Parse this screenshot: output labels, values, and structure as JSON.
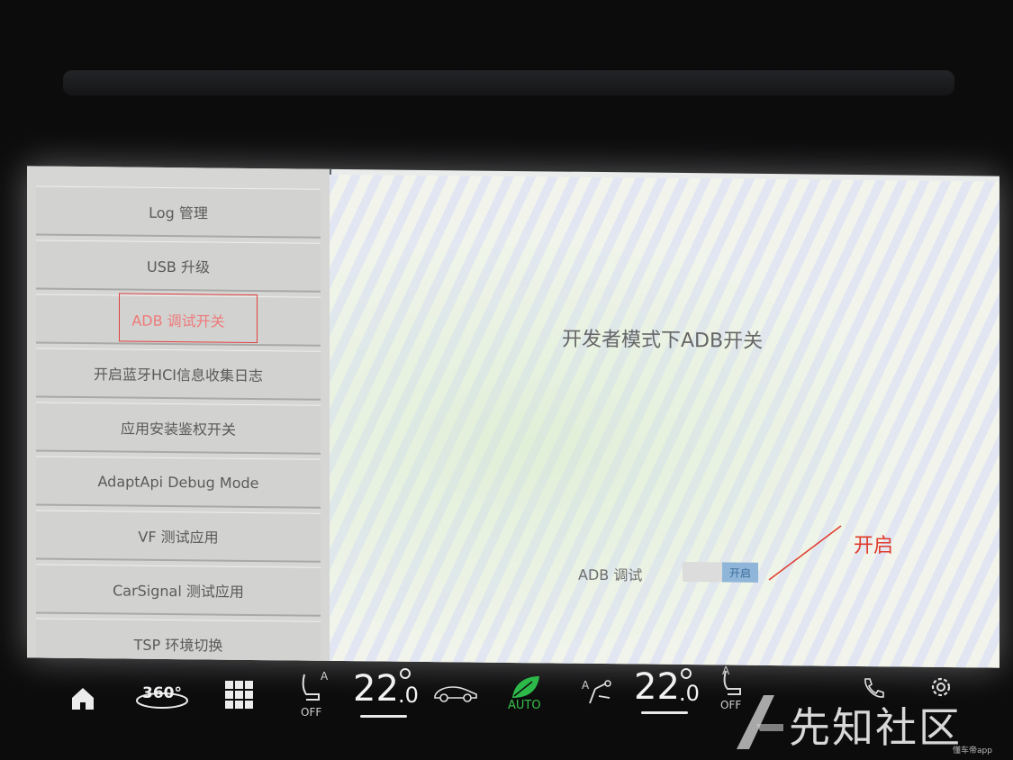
{
  "sidebar": {
    "items": [
      {
        "label": "Log 管理"
      },
      {
        "label": "USB 升级"
      },
      {
        "label": "ADB 调试开关"
      },
      {
        "label": "开启蓝牙HCI信息收集日志"
      },
      {
        "label": "应用安装鉴权开关"
      },
      {
        "label": "AdaptApi Debug Mode"
      },
      {
        "label": "VF 测试应用"
      },
      {
        "label": "CarSignal 测试应用"
      },
      {
        "label": "TSP 环境切换"
      }
    ],
    "active_index": 2
  },
  "content": {
    "title": "开发者模式下ADB开关",
    "adb_label": "ADB 调试",
    "toggle_text": "开启",
    "toggle_on": true
  },
  "annotation": {
    "text": "开启",
    "color": "#e03a2a"
  },
  "dock": {
    "icons": [
      "home-icon",
      "360-view-icon",
      "apps-grid-icon",
      "driver-seat-icon",
      "car-icon",
      "eco-leaf-icon",
      "fan-icon",
      "passenger-seat-icon",
      "phone-icon",
      "gear-icon"
    ],
    "view_360_label": "360°",
    "driver_seat_badge": "A",
    "driver_seat_status": "OFF",
    "driver_temp_main": "22",
    "driver_temp_decimal": ".0",
    "auto_label": "AUTO",
    "fan_badge": "A",
    "passenger_temp_main": "22",
    "passenger_temp_decimal": ".0",
    "passenger_seat_badge": "A",
    "passenger_seat_status": "OFF"
  },
  "watermark": {
    "text": "先知社区",
    "sub": "懂车帝app"
  }
}
